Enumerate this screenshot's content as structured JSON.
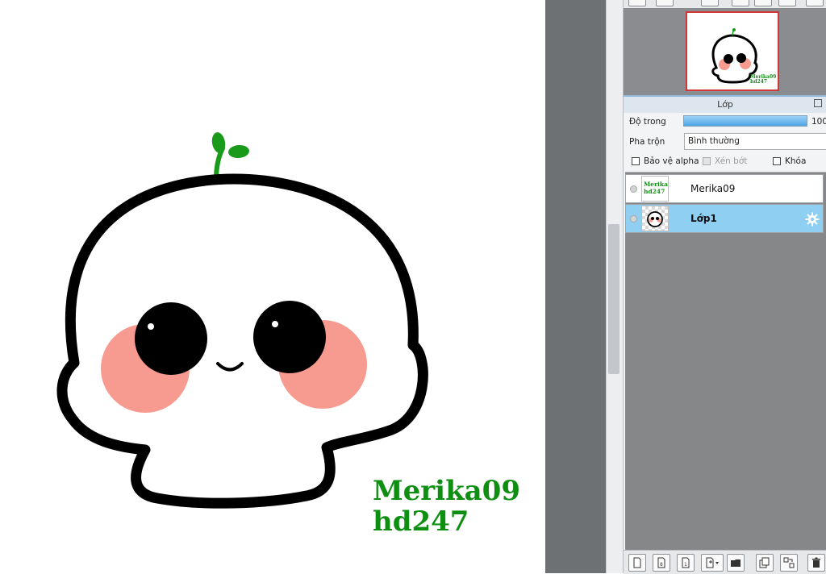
{
  "watermark": {
    "line1": "Merika09",
    "line2": "hd247"
  },
  "layer_panel": {
    "title": "Lớp",
    "opacity_label": "Độ trong",
    "opacity_value": "100",
    "opacity_percent": 100,
    "blend_label": "Pha trộn",
    "blend_value": "Bình thường",
    "protect_alpha_label": "Bảo vệ alpha",
    "clipping_label": "Xén bớt",
    "lock_label": "Khóa"
  },
  "layers": [
    {
      "name": "Merika09",
      "selected": false
    },
    {
      "name": "Lớp1",
      "selected": true
    }
  ],
  "colors": {
    "selected_row": "#8fcff2",
    "watermark_green": "#0f8f12",
    "blush": "#f79a8f",
    "nav_border": "#d23737"
  }
}
